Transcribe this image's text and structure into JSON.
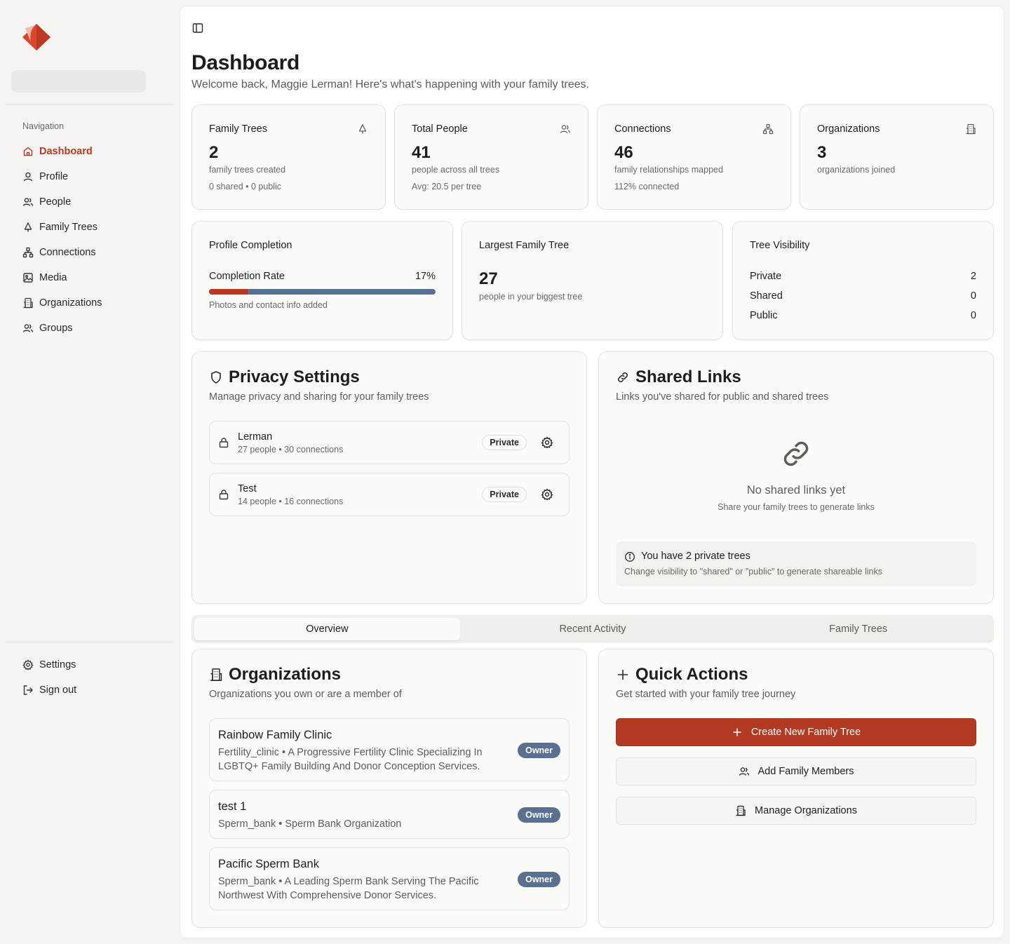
{
  "sidebar": {
    "section_label": "Navigation",
    "nav": [
      {
        "label": "Dashboard",
        "icon": "home-icon"
      },
      {
        "label": "Profile",
        "icon": "user-icon"
      },
      {
        "label": "People",
        "icon": "users-icon"
      },
      {
        "label": "Family Trees",
        "icon": "tree-icon"
      },
      {
        "label": "Connections",
        "icon": "network-icon"
      },
      {
        "label": "Media",
        "icon": "image-icon"
      },
      {
        "label": "Organizations",
        "icon": "building-icon"
      },
      {
        "label": "Groups",
        "icon": "users-icon"
      }
    ],
    "bottom": [
      {
        "label": "Settings",
        "icon": "gear-icon"
      },
      {
        "label": "Sign out",
        "icon": "sign-out-icon"
      }
    ]
  },
  "header": {
    "title": "Dashboard",
    "subtitle": "Welcome back, Maggie Lerman! Here's what's happening with your family trees."
  },
  "stats": [
    {
      "title": "Family Trees",
      "value": "2",
      "desc": "family trees created",
      "desc2": "0 shared • 0 public",
      "icon": "tree-icon"
    },
    {
      "title": "Total People",
      "value": "41",
      "desc": "people across all trees",
      "desc2": "Avg: 20.5 per tree",
      "icon": "users-icon"
    },
    {
      "title": "Connections",
      "value": "46",
      "desc": "family relationships mapped",
      "desc2": "112% connected",
      "icon": "network-icon"
    },
    {
      "title": "Organizations",
      "value": "3",
      "desc": "organizations joined",
      "desc2": "",
      "icon": "building-icon"
    }
  ],
  "profile_completion": {
    "title": "Profile Completion",
    "rate_label": "Completion Rate",
    "rate_text": "17%",
    "rate_fraction": 0.17,
    "note": "Photos and contact info added"
  },
  "largest_tree": {
    "title": "Largest Family Tree",
    "value": "27",
    "desc": "people in your biggest tree"
  },
  "visibility": {
    "title": "Tree Visibility",
    "rows": [
      {
        "label": "Private",
        "value": "2"
      },
      {
        "label": "Shared",
        "value": "0"
      },
      {
        "label": "Public",
        "value": "0"
      }
    ]
  },
  "privacy": {
    "title": "Privacy Settings",
    "subtitle": "Manage privacy and sharing for your family trees",
    "trees": [
      {
        "name": "Lerman",
        "meta": "27 people • 30 connections",
        "badge": "Private"
      },
      {
        "name": "Test",
        "meta": "14 people • 16 connections",
        "badge": "Private"
      }
    ]
  },
  "shared_links": {
    "title": "Shared Links",
    "subtitle": "Links you've shared for public and shared trees",
    "empty_title": "No shared links yet",
    "empty_sub": "Share your family trees to generate links",
    "info_title": "You have 2 private trees",
    "info_sub": "Change visibility to \"shared\" or \"public\" to generate shareable links"
  },
  "tabs": [
    "Overview",
    "Recent Activity",
    "Family Trees"
  ],
  "organizations": {
    "title": "Organizations",
    "subtitle": "Organizations you own or are a member of",
    "items": [
      {
        "name": "Rainbow Family Clinic",
        "desc": "Fertility_clinic • A Progressive Fertility Clinic Specializing In LGBTQ+ Family Building And Donor Conception Services.",
        "badge": "Owner"
      },
      {
        "name": "test 1",
        "desc": "Sperm_bank • Sperm Bank Organization",
        "badge": "Owner"
      },
      {
        "name": "Pacific Sperm Bank",
        "desc": "Sperm_bank • A Leading Sperm Bank Serving The Pacific Northwest With Comprehensive Donor Services.",
        "badge": "Owner"
      }
    ]
  },
  "quick_actions": {
    "title": "Quick Actions",
    "subtitle": "Get started with your family tree journey",
    "buttons": [
      {
        "label": "Create New Family Tree",
        "icon": "plus-icon"
      },
      {
        "label": "Add Family Members",
        "icon": "users-icon"
      },
      {
        "label": "Manage Organizations",
        "icon": "building-icon"
      }
    ]
  },
  "colors": {
    "accent": "#b83a22",
    "badge_blue": "#5a7090"
  }
}
